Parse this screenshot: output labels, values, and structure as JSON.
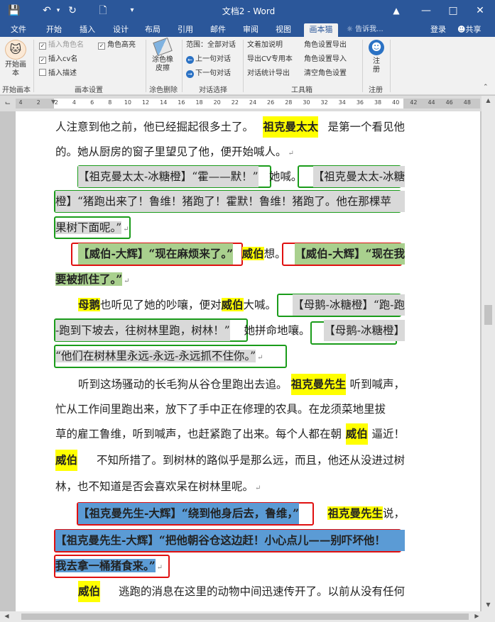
{
  "window": {
    "title": "文档2 - Word",
    "icons": [
      "save-icon",
      "undo-icon",
      "redo-icon",
      "new-doc-icon",
      "customize-icon",
      "ribbon-display-icon",
      "minimize-icon",
      "restore-icon",
      "close-icon"
    ]
  },
  "tabs": [
    "文件",
    "开始",
    "插入",
    "设计",
    "布局",
    "引用",
    "邮件",
    "审阅",
    "视图",
    "画本猫"
  ],
  "active_tab": "画本猫",
  "tell_me": "告诉我...",
  "login": "登录",
  "share": "共享",
  "ribbon": {
    "start_btn": "开始画本",
    "start_group": "开始画本",
    "cb_insert_role": "插入角色名",
    "cb_insert_cv": "插入cv名",
    "cb_insert_desc": "插入描述",
    "cb_role_highlight": "角色高亮",
    "settings_group": "画本设置",
    "erase_btn": "涂色橡皮擦",
    "erase_group": "涂色删除",
    "scope": "范围：全部对话",
    "prev_dialog": "上一句对话",
    "next_dialog": "下一句对话",
    "dialog_group": "对话选择",
    "tool1": "文着加说明",
    "tool2": "导出CV专用本",
    "tool3": "对话统计导出",
    "tool4": "角色设置导出",
    "tool5": "角色设置导入",
    "tool6": "清空角色设置",
    "tools_group": "工具箱",
    "register_btn": "注册",
    "register_group": "注册"
  },
  "ruler_numbers": [
    "4",
    "2",
    "2",
    "4",
    "6",
    "8",
    "10",
    "12",
    "14",
    "16",
    "18",
    "20",
    "22",
    "24",
    "26",
    "28",
    "30",
    "32",
    "34",
    "36",
    "38",
    "40",
    "42",
    "44",
    "46",
    "48"
  ],
  "document": {
    "l1": [
      "人注意到他之前，他已经掘起很多土了。",
      "祖克曼太太",
      "是第一个看见他"
    ],
    "l2": [
      "的。她从厨房的窗子里望见了他，便开始喊人。"
    ],
    "l3": [
      "【祖克曼太太-冰糖橙】“霍——默！”",
      "她喊。",
      "【祖克曼太太-冰糖"
    ],
    "l4": [
      "橙】“猪跑出来了！鲁维！猪跑了！霍默！鲁维！猪跑了。他在那棵苹"
    ],
    "l5": [
      "果树下面呢。”"
    ],
    "l6": [
      "【威伯-大辉】“现在麻烦来了。”",
      "威伯",
      "想。",
      "【威伯-大辉】“现在我"
    ],
    "l7": [
      "要被抓住了。”"
    ],
    "l8": [
      "母鹅",
      "也听见了她的吵嚷，便对",
      "威伯",
      "大喊。",
      "【母鹅-冰糖橙】“跑-跑"
    ],
    "l9": [
      "-跑到下坡去，往树林里跑，树林！”",
      "她拼命地嚷。",
      "【母鹅-冰糖橙】"
    ],
    "l10": [
      "“他们在树林里永远-永远-永远抓不住你。”"
    ],
    "l11": [
      "听到这场骚动的长毛狗从谷仓里跑出去追。",
      "祖克曼先生",
      "听到喊声，"
    ],
    "l12": [
      "忙从工作间里跑出来，放下了手中正在修理的农具。在龙须菜地里拔"
    ],
    "l13": [
      "草的雇工鲁维，听到喊声，也赶紧跑了出来。每个人都在朝",
      "威伯",
      "逼近！"
    ],
    "l14": [
      "威伯",
      "不知所措了。到树林的路似乎是那么远，而且，他还从没进过树"
    ],
    "l15": [
      "林，也不知道是否会喜欢呆在树林里呢。"
    ],
    "l16": [
      "【祖克曼先生-大辉】“绕到他身后去，鲁维，”",
      "祖克曼先生",
      "说，"
    ],
    "l17": [
      "【祖克曼先生-大辉】“把他朝谷仓这边赶！小心点儿——别吓坏他！"
    ],
    "l18": [
      "我去拿一桶猪食来。”"
    ],
    "l19": [
      "威伯",
      "逃跑的消息在这里的动物中间迅速传开了。以前从没有任何"
    ]
  }
}
